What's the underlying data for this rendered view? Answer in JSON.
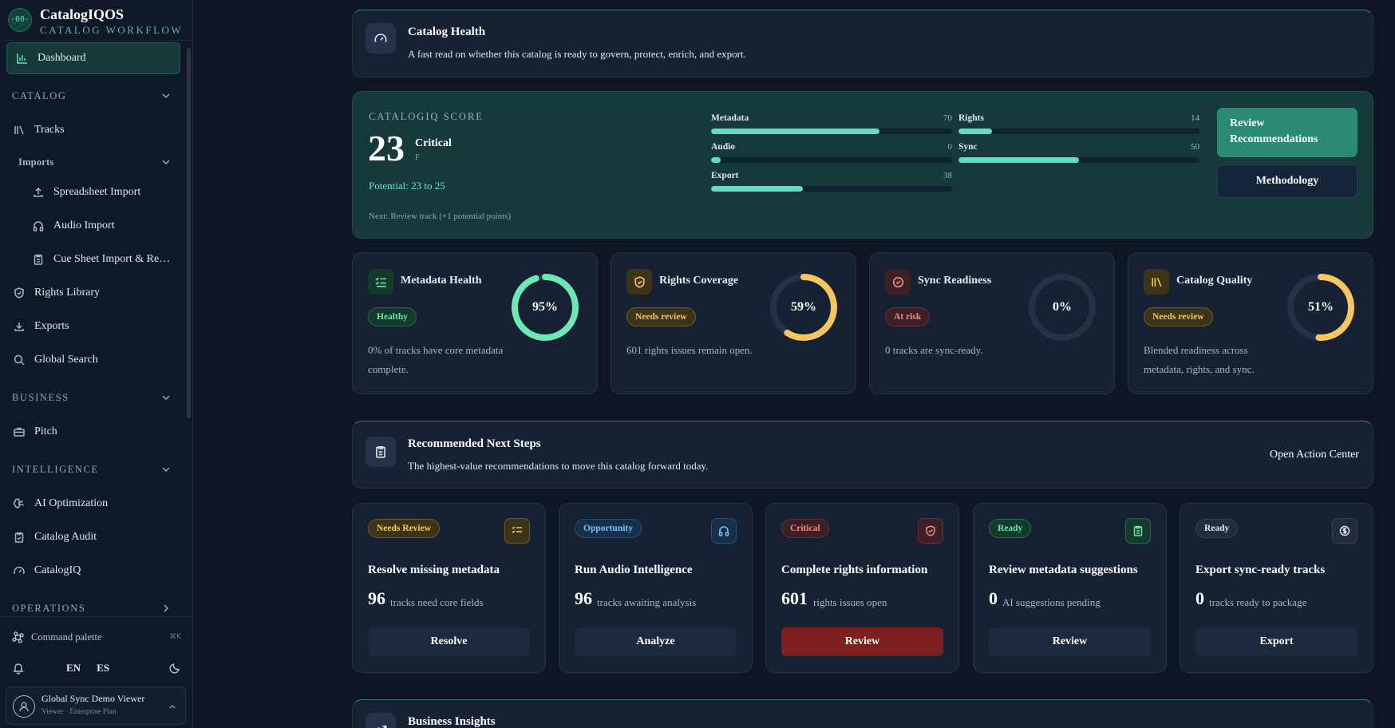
{
  "brand": {
    "name": "CatalogIQOS",
    "subtitle": "CATALOG WORKFLOW",
    "logo_text": "-00-"
  },
  "sidebar": {
    "dashboard": "Dashboard",
    "sections": {
      "catalog": "CATALOG",
      "imports": "Imports",
      "business": "BUSINESS",
      "intelligence": "INTELLIGENCE",
      "operations": "OPERATIONS"
    },
    "items": {
      "tracks": "Tracks",
      "spreadsheet_import": "Spreadsheet Import",
      "audio_import": "Audio Import",
      "cue_sheet": "Cue Sheet Import & Re…",
      "rights_library": "Rights Library",
      "exports": "Exports",
      "global_search": "Global Search",
      "pitch": "Pitch",
      "ai_optimization": "AI Optimization",
      "catalog_audit": "Catalog Audit",
      "catalogiq": "CatalogIQ"
    },
    "command_palette": "Command palette",
    "command_shortcut": "⌘K",
    "lang_en": "EN",
    "lang_es": "ES",
    "user": {
      "name": "Global Sync Demo Viewer",
      "role": "Viewer · Enterprise Plan"
    }
  },
  "health": {
    "title": "Catalog Health",
    "subtitle": "A fast read on whether this catalog is ready to govern, protect, enrich, and export."
  },
  "score": {
    "label": "CATALOGIQ SCORE",
    "value": "23",
    "status": "Critical",
    "grade": "F",
    "potential": "Potential: 23 to 25",
    "next": "Next: Review track (+1 potential points)",
    "bars": [
      {
        "name": "Metadata",
        "value": 70
      },
      {
        "name": "Rights",
        "value": 14
      },
      {
        "name": "Audio",
        "value": 0
      },
      {
        "name": "Sync",
        "value": 50
      },
      {
        "name": "Export",
        "value": 38
      }
    ],
    "review_button": "Review Recommendations",
    "methodology_button": "Methodology"
  },
  "cards": [
    {
      "title": "Metadata Health",
      "badge": "Healthy",
      "desc": "0% of tracks have core metadata complete.",
      "pct": 95,
      "pct_label": "95%",
      "color": "#6ee7b7"
    },
    {
      "title": "Rights Coverage",
      "badge": "Needs review",
      "desc": "601 rights issues remain open.",
      "pct": 59,
      "pct_label": "59%",
      "color": "#f5c75e"
    },
    {
      "title": "Sync Readiness",
      "badge": "At risk",
      "desc": "0 tracks are sync-ready.",
      "pct": 0,
      "pct_label": "0%",
      "color": "#f08b8b"
    },
    {
      "title": "Catalog Quality",
      "badge": "Needs review",
      "desc": "Blended readiness across metadata, rights, and sync.",
      "pct": 51,
      "pct_label": "51%",
      "color": "#f5c75e"
    }
  ],
  "steps": {
    "title": "Recommended Next Steps",
    "subtitle": "The highest-value recommendations to move this catalog forward today.",
    "action": "Open Action Center",
    "items": [
      {
        "badge": "Needs Review",
        "title": "Resolve missing metadata",
        "num": "96",
        "text": "tracks need core fields",
        "button": "Resolve"
      },
      {
        "badge": "Opportunity",
        "title": "Run Audio Intelligence",
        "num": "96",
        "text": "tracks awaiting analysis",
        "button": "Analyze"
      },
      {
        "badge": "Critical",
        "title": "Complete rights information",
        "num": "601",
        "text": "rights issues open",
        "button": "Review"
      },
      {
        "badge": "Ready",
        "title": "Review metadata suggestions",
        "num": "0",
        "text": "AI suggestions pending",
        "button": "Review"
      },
      {
        "badge": "Ready",
        "title": "Export sync-ready tracks",
        "num": "0",
        "text": "tracks ready to package",
        "button": "Export"
      }
    ]
  },
  "insights": {
    "title": "Business Insights"
  }
}
